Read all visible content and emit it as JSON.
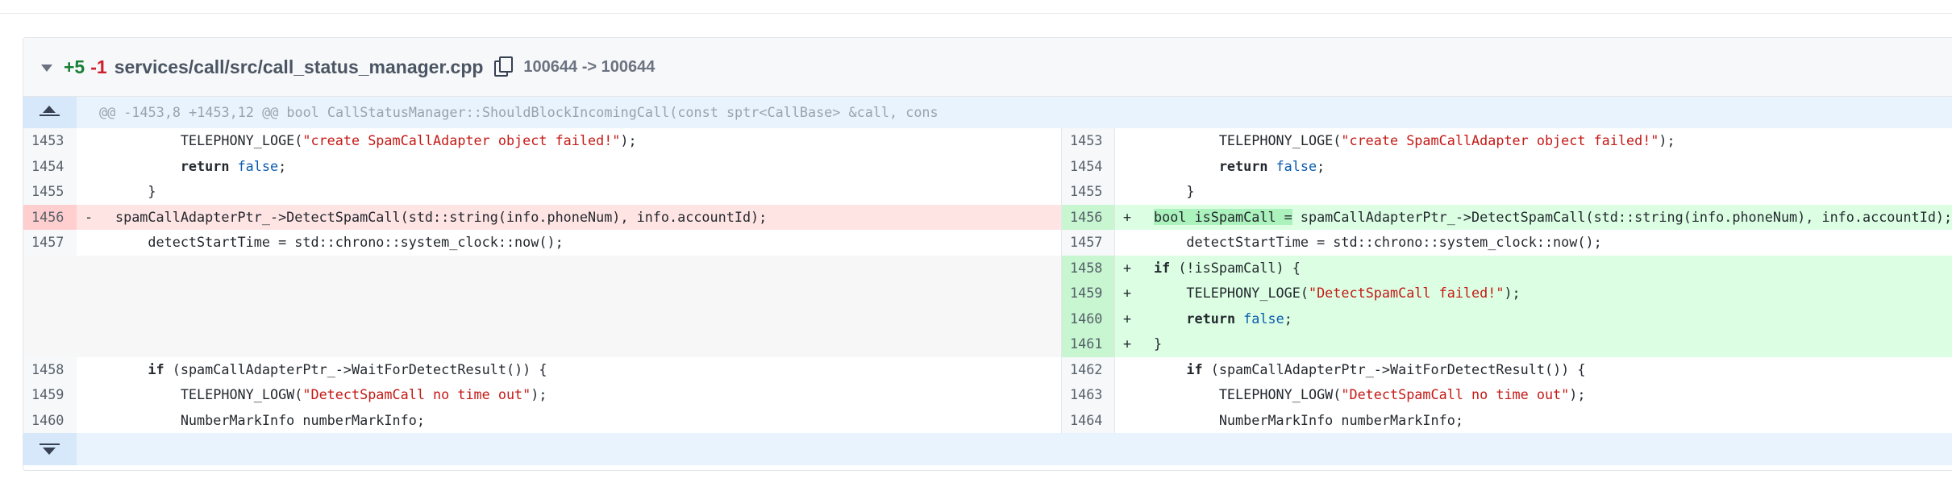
{
  "file": {
    "added_count": "+5",
    "removed_count": "-1",
    "path": "services/call/src/call_status_manager.cpp",
    "mode": "100644 -> 100644",
    "copy_icon": "copy-icon",
    "collapse_icon": "chevron-down-icon"
  },
  "hunk": {
    "header": "@@ -1453,8 +1453,12 @@ bool CallStatusManager::ShouldBlockIncomingCall(const sptr<CallBase> &call, cons",
    "expand_up_icon": "expand-up-icon",
    "expand_down_icon": "expand-down-icon"
  },
  "colors": {
    "added": "#1a7f37",
    "removed": "#cf222e",
    "insert_bg": "#dcffe4",
    "delete_bg": "#ffe4e4"
  },
  "rows": [
    {
      "type": "ctx",
      "l_num": "1453",
      "r_num": "1453",
      "l_sign": "",
      "r_sign": "",
      "l_code": [
        [
          "        TELEPHONY_LOGE(",
          ""
        ],
        [
          "\"create SpamCallAdapter object failed!\"",
          "str"
        ],
        [
          ");",
          ""
        ]
      ],
      "r_code": [
        [
          "        TELEPHONY_LOGE(",
          ""
        ],
        [
          "\"create SpamCallAdapter object failed!\"",
          "str"
        ],
        [
          ");",
          ""
        ]
      ]
    },
    {
      "type": "ctx",
      "l_num": "1454",
      "r_num": "1454",
      "l_sign": "",
      "r_sign": "",
      "l_code": [
        [
          "        ",
          ""
        ],
        [
          "return",
          "b"
        ],
        [
          " ",
          ""
        ],
        [
          "false",
          "kw"
        ],
        [
          ";",
          ""
        ]
      ],
      "r_code": [
        [
          "        ",
          ""
        ],
        [
          "return",
          "b"
        ],
        [
          " ",
          ""
        ],
        [
          "false",
          "kw"
        ],
        [
          ";",
          ""
        ]
      ]
    },
    {
      "type": "ctx",
      "l_num": "1455",
      "r_num": "1455",
      "l_sign": "",
      "r_sign": "",
      "l_code": [
        [
          "    }",
          ""
        ]
      ],
      "r_code": [
        [
          "    }",
          ""
        ]
      ]
    },
    {
      "type": "mod",
      "l_num": "1456",
      "r_num": "1456",
      "l_sign": "-",
      "r_sign": "+",
      "l_code": [
        [
          "spamCallAdapterPtr_->DetectSpamCall(std::string(info.phoneNum), info.accountId);",
          ""
        ]
      ],
      "r_code": [
        [
          "bool isSpamCall =",
          "hl"
        ],
        [
          " spamCallAdapterPtr_->DetectSpamCall(std::string(info.phoneNum), info.accountId);",
          ""
        ]
      ]
    },
    {
      "type": "ctx",
      "l_num": "1457",
      "r_num": "1457",
      "l_sign": "",
      "r_sign": "",
      "l_code": [
        [
          "    detectStartTime = std::chrono::system_clock::now();",
          ""
        ]
      ],
      "r_code": [
        [
          "    detectStartTime = std::chrono::system_clock::now();",
          ""
        ]
      ]
    },
    {
      "type": "add",
      "l_num": "",
      "r_num": "1458",
      "l_sign": "",
      "r_sign": "+",
      "l_code": [],
      "r_code": [
        [
          "if",
          "b"
        ],
        [
          " (!isSpamCall) {",
          ""
        ]
      ]
    },
    {
      "type": "add",
      "l_num": "",
      "r_num": "1459",
      "l_sign": "",
      "r_sign": "+",
      "l_code": [],
      "r_code": [
        [
          "    TELEPHONY_LOGE(",
          ""
        ],
        [
          "\"DetectSpamCall failed!\"",
          "str"
        ],
        [
          ");",
          ""
        ]
      ]
    },
    {
      "type": "add",
      "l_num": "",
      "r_num": "1460",
      "l_sign": "",
      "r_sign": "+",
      "l_code": [],
      "r_code": [
        [
          "    ",
          ""
        ],
        [
          "return",
          "b"
        ],
        [
          " ",
          ""
        ],
        [
          "false",
          "kw"
        ],
        [
          ";",
          ""
        ]
      ]
    },
    {
      "type": "add",
      "l_num": "",
      "r_num": "1461",
      "l_sign": "",
      "r_sign": "+",
      "l_code": [],
      "r_code": [
        [
          "}",
          ""
        ]
      ]
    },
    {
      "type": "ctx",
      "l_num": "1458",
      "r_num": "1462",
      "l_sign": "",
      "r_sign": "",
      "l_code": [
        [
          "    ",
          ""
        ],
        [
          "if",
          "b"
        ],
        [
          " (spamCallAdapterPtr_->WaitForDetectResult()) {",
          ""
        ]
      ],
      "r_code": [
        [
          "    ",
          ""
        ],
        [
          "if",
          "b"
        ],
        [
          " (spamCallAdapterPtr_->WaitForDetectResult()) {",
          ""
        ]
      ]
    },
    {
      "type": "ctx",
      "l_num": "1459",
      "r_num": "1463",
      "l_sign": "",
      "r_sign": "",
      "l_code": [
        [
          "        TELEPHONY_LOGW(",
          ""
        ],
        [
          "\"DetectSpamCall no time out\"",
          "str"
        ],
        [
          ");",
          ""
        ]
      ],
      "r_code": [
        [
          "        TELEPHONY_LOGW(",
          ""
        ],
        [
          "\"DetectSpamCall no time out\"",
          "str"
        ],
        [
          ");",
          ""
        ]
      ]
    },
    {
      "type": "ctx",
      "l_num": "1460",
      "r_num": "1464",
      "l_sign": "",
      "r_sign": "",
      "l_code": [
        [
          "        NumberMarkInfo numberMarkInfo;",
          ""
        ]
      ],
      "r_code": [
        [
          "        NumberMarkInfo numberMarkInfo;",
          ""
        ]
      ]
    }
  ]
}
